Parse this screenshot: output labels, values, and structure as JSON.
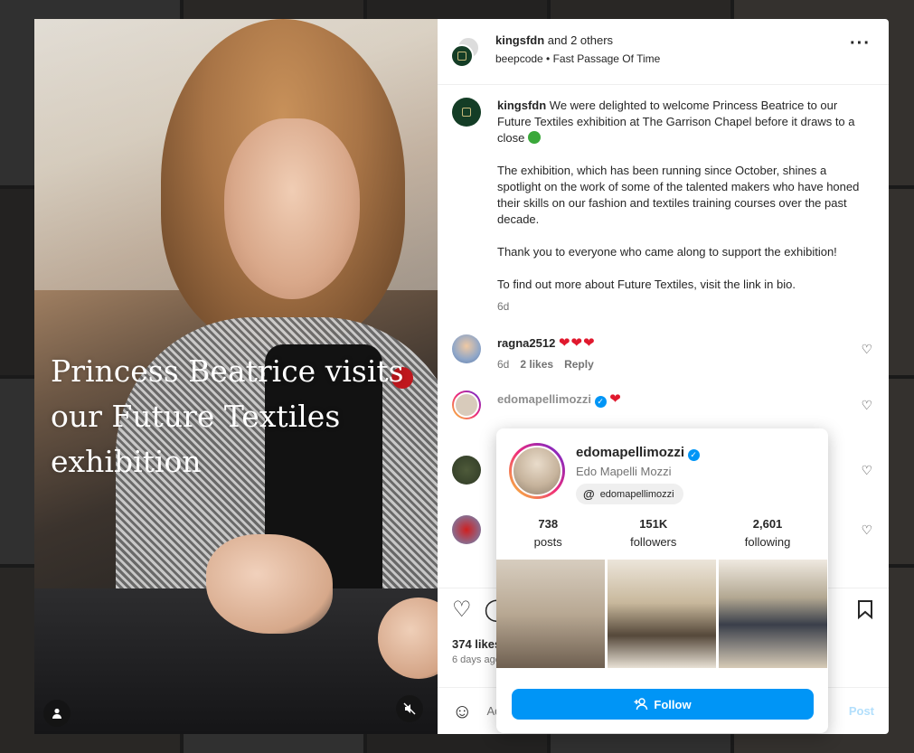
{
  "post": {
    "overlay_title": "Princess Beatrice visits our Future Textiles exhibition",
    "header": {
      "username": "kingsfdn",
      "coauthors": " and 2 others",
      "audio_artist": "beepcode",
      "audio_separator": " • ",
      "audio_title": "Fast Passage Of Time"
    },
    "caption": {
      "username": "kingsfdn",
      "p1": " We were delighted to welcome Princess Beatrice to our Future Textiles exhibition at The Garrison Chapel before it draws to a close ",
      "p2": "The exhibition, which has been running since October, shines a spotlight on the work of some of the talented makers who have honed their skills on our fashion and textiles training courses over the past decade.",
      "p3": "Thank you to everyone who came along to support the exhibition!",
      "p4": "To find out more about Future Textiles, visit the link in bio.",
      "time": "6d"
    },
    "comments": [
      {
        "username": "ragna2512",
        "text": "❤❤❤",
        "time": "6d",
        "likes": "2 likes",
        "reply": "Reply"
      },
      {
        "username": "edomapellimozzi",
        "text": "❤"
      }
    ],
    "likes": "374 likes",
    "ago": "6 days ago",
    "add_comment_placeholder": "Add a comment...",
    "post_label": "Post"
  },
  "hover_card": {
    "username": "edomapellimozzi",
    "full_name": "Edo Mapelli Mozzi",
    "threads_handle": "edomapellimozzi",
    "stats": [
      {
        "num": "738",
        "label": "posts"
      },
      {
        "num": "151K",
        "label": "followers"
      },
      {
        "num": "2,601",
        "label": "following"
      }
    ],
    "follow_label": "Follow"
  },
  "icons": {
    "more": "more-options-icon",
    "heart": "heart-icon",
    "comment": "comment-icon",
    "bookmark": "bookmark-icon",
    "emoji": "emoji-icon",
    "user": "user-tag-icon",
    "mute": "mute-icon",
    "verified": "verified-badge-icon",
    "threads": "threads-icon",
    "follow": "add-user-icon"
  },
  "colors": {
    "accent": "#0095f6",
    "heart_red": "#e0182d",
    "crest_green": "#143d26"
  }
}
